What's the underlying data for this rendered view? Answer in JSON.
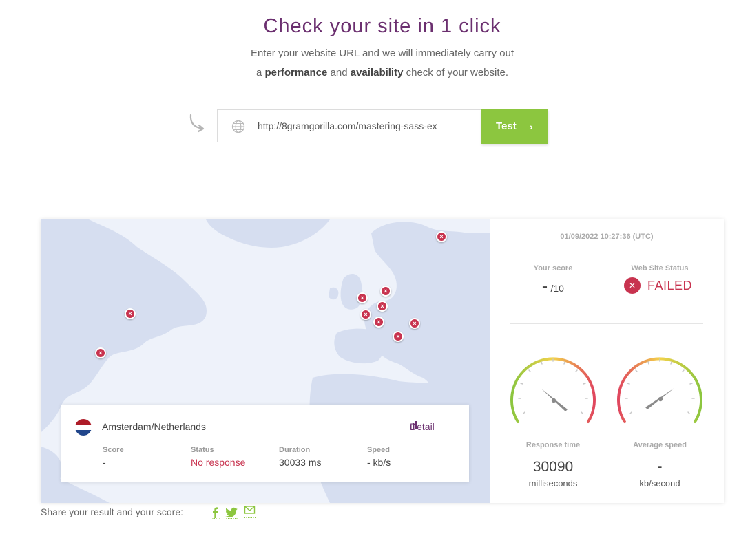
{
  "hero": {
    "title": "Check your site in 1 click",
    "line1": "Enter your website URL and we will immediately carry out",
    "line2_pre": "a ",
    "line2_b1": "performance",
    "line2_mid": " and ",
    "line2_b2": "availability",
    "line2_post": " check of your website."
  },
  "search": {
    "url_value": "http://8gramgorilla.com/mastering-sass-ex",
    "test_label": "Test",
    "chevron": "›",
    "globe_icon": "globe-icon",
    "arrow_icon": "curved-arrow-icon"
  },
  "map": {
    "pin_glyph": "×",
    "pin_color": "#c8334f",
    "location": {
      "name": "Amsterdam/Netherlands",
      "detail_label": "Detail",
      "flag_colors": [
        "#ae1c28",
        "#ffffff",
        "#21468b"
      ],
      "metrics": [
        {
          "label": "Score",
          "value": "-",
          "status": "normal"
        },
        {
          "label": "Status",
          "value": "No response",
          "status": "error"
        },
        {
          "label": "Duration",
          "value": "30033 ms",
          "status": "normal"
        },
        {
          "label": "Speed",
          "value": "- kb/s",
          "status": "normal"
        }
      ]
    }
  },
  "results": {
    "timestamp": "01/09/2022 10:27:36 (UTC)",
    "score_label": "Your score",
    "score_value": "-",
    "score_max": "/10",
    "status_label": "Web Site Status",
    "status_value": "FAILED",
    "status_color": "#c8334f",
    "response": {
      "label": "Response time",
      "value": "30090",
      "unit": "milliseconds"
    },
    "speed": {
      "label": "Average speed",
      "value": "-",
      "unit": "kb/second"
    }
  },
  "share": {
    "label": "Share your result and your score:",
    "icons": [
      "facebook-icon",
      "twitter-icon",
      "email-icon"
    ]
  },
  "colors": {
    "accent": "#6b2f6f",
    "button": "#8cc63f",
    "error": "#c8334f"
  }
}
